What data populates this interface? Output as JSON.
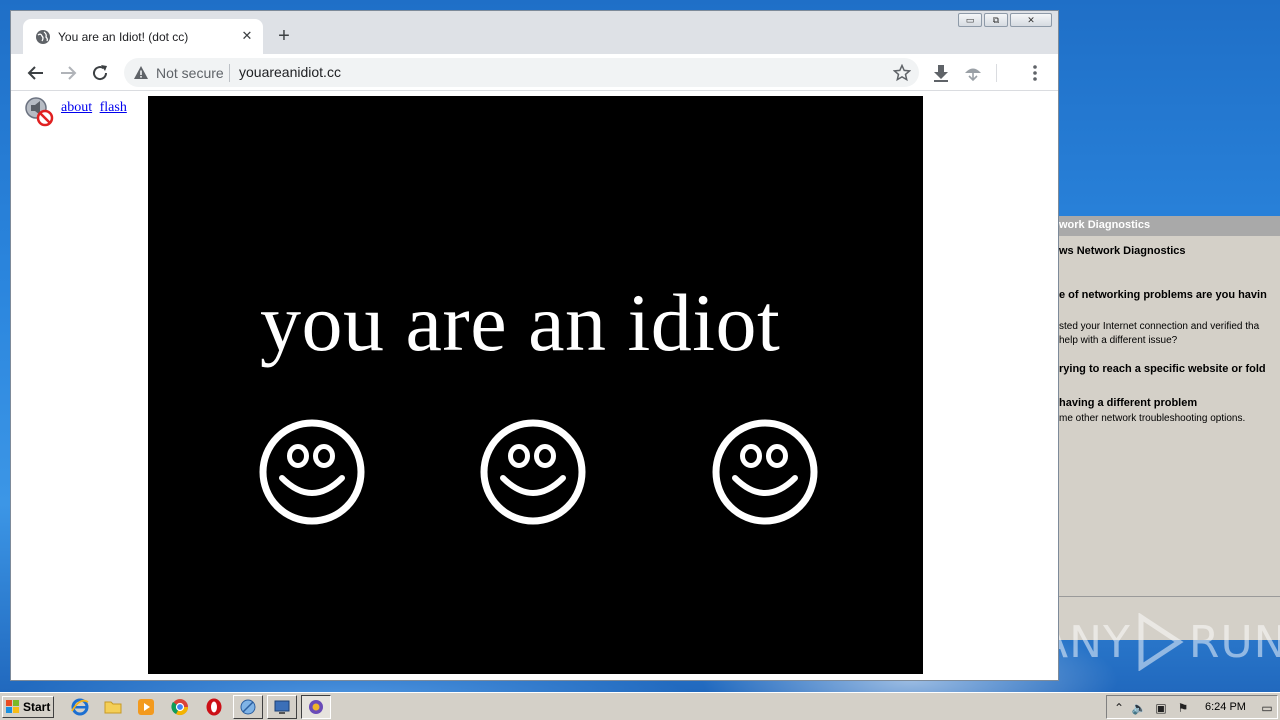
{
  "browser": {
    "tab": {
      "title": "You are an Idiot! (dot cc)"
    },
    "toolbar": {
      "security_label": "Not secure",
      "url": "youareanidiot.cc"
    },
    "window_controls": {
      "minimize": "▭",
      "restore": "⧉",
      "close": "✕"
    }
  },
  "page": {
    "links": [
      "about",
      "flash"
    ],
    "headline": "you are an idiot",
    "colors": {
      "stage_bg": "#000000",
      "text": "#ffffff",
      "link": "#0000ee"
    }
  },
  "network_diagnostics": {
    "title": "work Diagnostics",
    "heading": "ws Network Diagnostics",
    "question": "e of networking problems are you havin",
    "para_line1": "sted your Internet connection and verified tha",
    "para_line2": "help with a different issue?",
    "option1": "rying to reach a specific website or fold",
    "option2": "having a different problem",
    "option2_desc": "me other network troubleshooting options."
  },
  "watermark": {
    "left": "ANY",
    "right": "RUN"
  },
  "taskbar": {
    "start_label": "Start",
    "clock": "6:24 PM"
  }
}
